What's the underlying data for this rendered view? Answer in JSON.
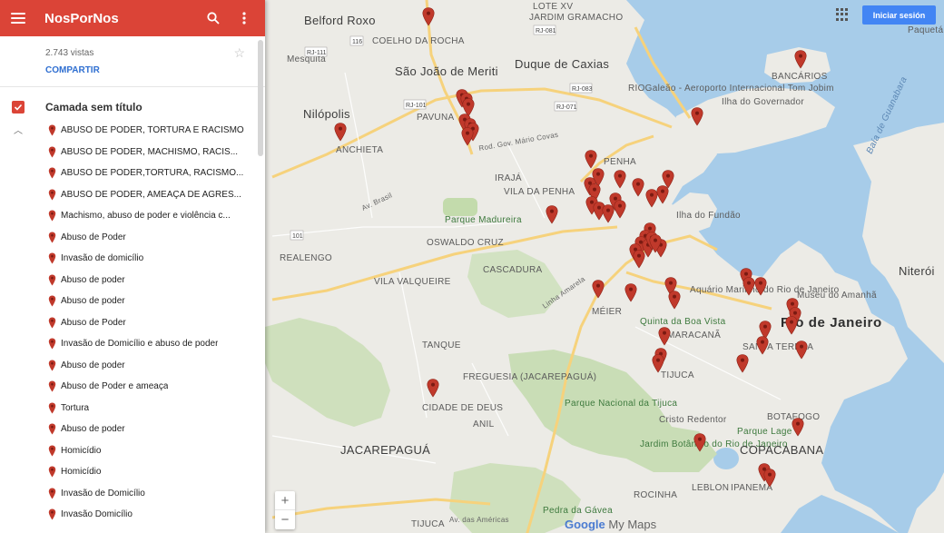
{
  "app": {
    "title": "NosPorNos"
  },
  "info": {
    "views": "2.743 vistas",
    "share_label": "COMPARTIR"
  },
  "layer": {
    "title": "Camada sem título",
    "items": [
      "ABUSO DE PODER, TORTURA E RACISMO",
      "ABUSO DE PODER, MACHISMO, RACIS...",
      "ABUSO DE PODER,TORTURA, RACISMO...",
      "ABUSO DE PODER, AMEAÇA DE AGRES...",
      "Machismo, abuso de poder e violência c...",
      "Abuso de Poder",
      "Invasão de domicílio",
      "Abuso de poder",
      "Abuso de poder",
      "Abuso de Poder",
      "Invasão de Domicílio e abuso de poder",
      "Abuso de poder",
      "Abuso de Poder e ameaça",
      "Tortura",
      "Abuso de poder",
      "Homicídio",
      "Homicídio",
      "Invasão de Domicílio",
      "Invasão Domicílio"
    ]
  },
  "topbar": {
    "signin_label": "Iniciar sesión"
  },
  "zoom": {
    "in": "+",
    "out": "−"
  },
  "logo": {
    "google": "Google",
    "mymaps": " My Maps"
  },
  "colors": {
    "header": "#db4437",
    "marker": "#c0392b",
    "water": "#a6cbe8",
    "park": "#c7dcb4",
    "land": "#eceae5",
    "highway": "#f7d27a",
    "signin": "#4285f4"
  },
  "icons": [
    "menu-icon",
    "search-icon",
    "more-vert-icon",
    "star-icon",
    "check-icon",
    "collapse-icon",
    "map-pin-icon",
    "apps-icon",
    "zoom-in-icon",
    "zoom-out-icon"
  ],
  "map": {
    "labels": {
      "belford_roxo": "Belford Roxo",
      "lote_xv": "LOTE XV",
      "jd_gramacho": "JARDIM GRAMACHO",
      "coelho_da_rocha": "COELHO DA ROCHA",
      "sao_joao": "São João de Meriti",
      "duque": "Duque de Caxias",
      "mesquita": "Mesquita",
      "nilopolis": "Nilópolis",
      "pavuna": "PAVUNA",
      "anchieta": "ANCHIETA",
      "galeao": "RIOGaleão - Aeroporto Internacional Tom Jobim",
      "ilha_gov": "Ilha do Governador",
      "bancarios": "BANCÁRIOS",
      "paqueta": "Paquetá",
      "baia": "Baía de Guanabara",
      "penha": "PENHA",
      "iraja": "IRAJÁ",
      "vila_penha": "VILA DA PENHA",
      "madureira": "Parque Madureira",
      "ilha_fundao": "Ilha do Fundão",
      "oswaldo": "OSWALDO CRUZ",
      "realengo": "REALENGO",
      "cascadura": "CASCADURA",
      "vila_valqueire": "VILA VALQUEIRE",
      "meier": "MÉIER",
      "quinta": "Quinta da Boa Vista",
      "aquario": "Aquário Marinho do Rio de Janeiro",
      "museu": "Museu do Amanhã",
      "rio": "Rio de Janeiro",
      "niteroi": "Niterói",
      "maracana": "MARACANÃ",
      "santa_teresa": "SANTA TERESA",
      "tanque": "TANQUE",
      "tijuca": "TIJUCA",
      "freguesia": "FREGUESIA (JACAREPAGUÁ)",
      "cidade_deus": "CIDADE DE DEUS",
      "anil": "ANIL",
      "parque_tijuca": "Parque Nacional da Tijuca",
      "cristo": "Cristo Redentor",
      "parque_lage": "Parque Lage",
      "botafogo": "BOTAFOGO",
      "jacarepagua": "JACAREPAGUÁ",
      "jardim_botanico": "Jardim Botânico do Rio de Janeiro",
      "copacabana": "COPACABANA",
      "leblon": "LEBLON",
      "ipanema": "IPANEMA",
      "rocinha": "ROCINHA",
      "pedra": "Pedra da Gávea",
      "tijuca_bottom": "TIJUCA",
      "av_americas": "Av. das Américas",
      "av_brasil": "Av. Brasil",
      "rod_gov": "Rod. Gov. Mário Covas",
      "linha_amarela": "Linha Amarela",
      "r101": "101",
      "r116": "116",
      "rj081": "RJ-081",
      "rj071": "RJ-071",
      "rj083": "RJ-083",
      "rj101": "RJ-101",
      "rj111": "RJ-111"
    }
  }
}
